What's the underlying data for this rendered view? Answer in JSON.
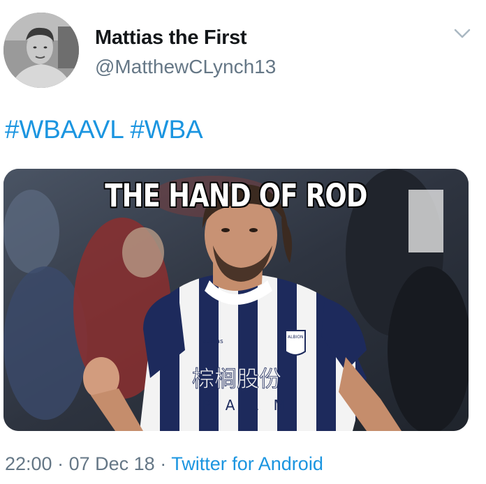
{
  "user": {
    "display_name": "Mattias the First",
    "handle": "@MatthewCLynch13"
  },
  "tweet": {
    "hashtags": [
      "#WBAAVL",
      "#WBA"
    ],
    "media": {
      "caption": "THE HAND OF ROD",
      "shirt_sponsor": "棕榈股份",
      "shirt_sponsor_latin": "PALM",
      "badge_text": "ALBION",
      "maker_text": "adidas"
    },
    "time": "22:00",
    "separator": "·",
    "date": "07 Dec 18",
    "source": "Twitter for Android"
  },
  "icons": {
    "chevron": "chevron-down-icon",
    "avatar": "avatar-photo"
  },
  "colors": {
    "link": "#1b95e0",
    "secondary_text": "#657786",
    "primary_text": "#14171a",
    "kit_navy": "#1d2a5c"
  }
}
